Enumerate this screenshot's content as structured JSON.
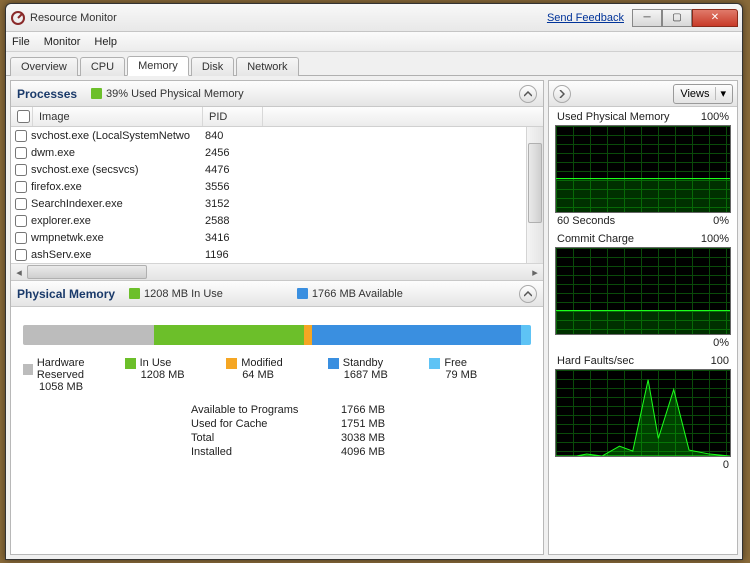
{
  "window": {
    "title": "Resource Monitor",
    "feedback": "Send Feedback"
  },
  "menu": {
    "file": "File",
    "monitor": "Monitor",
    "help": "Help"
  },
  "tabs": {
    "overview": "Overview",
    "cpu": "CPU",
    "memory": "Memory",
    "disk": "Disk",
    "network": "Network"
  },
  "processes": {
    "title": "Processes",
    "usage_label": "39% Used Physical Memory",
    "col_image": "Image",
    "col_pid": "PID",
    "rows": [
      {
        "image": "svchost.exe (LocalSystemNetwo",
        "pid": "840"
      },
      {
        "image": "dwm.exe",
        "pid": "2456"
      },
      {
        "image": "svchost.exe (secsvcs)",
        "pid": "4476"
      },
      {
        "image": "firefox.exe",
        "pid": "3556"
      },
      {
        "image": "SearchIndexer.exe",
        "pid": "3152"
      },
      {
        "image": "explorer.exe",
        "pid": "2588"
      },
      {
        "image": "wmpnetwk.exe",
        "pid": "3416"
      },
      {
        "image": "ashServ.exe",
        "pid": "1196"
      }
    ]
  },
  "physmem": {
    "title": "Physical Memory",
    "in_use_label": "1208 MB In Use",
    "available_label": "1766 MB Available",
    "legend": {
      "hardware": {
        "label": "Hardware Reserved",
        "value": "1058 MB"
      },
      "inuse": {
        "label": "In Use",
        "value": "1208 MB"
      },
      "modified": {
        "label": "Modified",
        "value": "64 MB"
      },
      "standby": {
        "label": "Standby",
        "value": "1687 MB"
      },
      "free": {
        "label": "Free",
        "value": "79 MB"
      }
    },
    "stats": {
      "avail_label": "Available to Programs",
      "avail_val": "1766 MB",
      "cache_label": "Used for Cache",
      "cache_val": "1751 MB",
      "total_label": "Total",
      "total_val": "3038 MB",
      "installed_label": "Installed",
      "installed_val": "4096 MB"
    }
  },
  "right": {
    "views": "Views",
    "g1": {
      "title": "Used Physical Memory",
      "max": "100%",
      "foot_l": "60 Seconds",
      "foot_r": "0%"
    },
    "g2": {
      "title": "Commit Charge",
      "max": "100%",
      "foot_r": "0%"
    },
    "g3": {
      "title": "Hard Faults/sec",
      "max": "100",
      "foot_r": "0"
    }
  },
  "colors": {
    "green": "#6cbf2a",
    "orange": "#f5a623",
    "blue": "#3a8fe0",
    "cyan": "#5ec3f5",
    "gray": "#bcbcbc"
  },
  "chart_data": [
    {
      "type": "area",
      "title": "Used Physical Memory",
      "ylim": [
        0,
        100
      ],
      "ylabel": "%",
      "x_seconds": 60,
      "values_pct": [
        39,
        39,
        39,
        39,
        39,
        39,
        39,
        39,
        39,
        40,
        39,
        39
      ]
    },
    {
      "type": "area",
      "title": "Commit Charge",
      "ylim": [
        0,
        100
      ],
      "ylabel": "%",
      "x_seconds": 60,
      "values_pct": [
        28,
        28,
        28,
        28,
        28,
        28,
        28,
        28,
        28,
        28,
        28,
        28
      ]
    },
    {
      "type": "area",
      "title": "Hard Faults/sec",
      "ylim": [
        0,
        100
      ],
      "ylabel": "faults/sec",
      "x_seconds": 60,
      "values": [
        0,
        0,
        0,
        2,
        0,
        10,
        5,
        90,
        20,
        70,
        5,
        0
      ]
    },
    {
      "type": "bar",
      "title": "Physical Memory Composition (MB)",
      "categories": [
        "Hardware Reserved",
        "In Use",
        "Modified",
        "Standby",
        "Free"
      ],
      "values": [
        1058,
        1208,
        64,
        1687,
        79
      ]
    }
  ]
}
